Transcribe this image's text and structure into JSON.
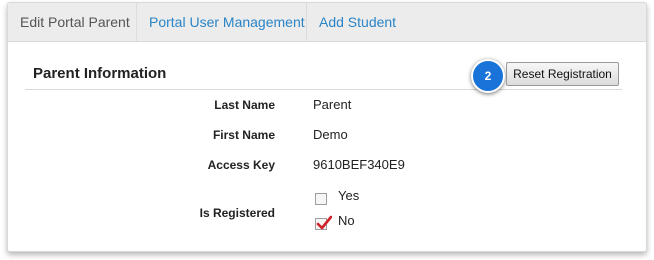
{
  "tabs": [
    {
      "label": "Edit Portal Parent",
      "active": true
    },
    {
      "label": "Portal User Management",
      "active": false
    },
    {
      "label": "Add Student",
      "active": false
    }
  ],
  "section": {
    "title": "Parent Information",
    "step_number": "2",
    "reset_label": "Reset Registration"
  },
  "fields": {
    "last_name": {
      "label": "Last Name",
      "value": "Parent"
    },
    "first_name": {
      "label": "First Name",
      "value": "Demo"
    },
    "access_key": {
      "label": "Access Key",
      "value": "9610BEF340E9"
    },
    "is_registered": {
      "label": "Is Registered",
      "options": [
        {
          "label": "Yes",
          "checked": false
        },
        {
          "label": "No",
          "checked": true
        }
      ]
    }
  },
  "colors": {
    "link": "#2a84c6",
    "badge": "#1a73d9",
    "checkmark": "#d0212a"
  }
}
